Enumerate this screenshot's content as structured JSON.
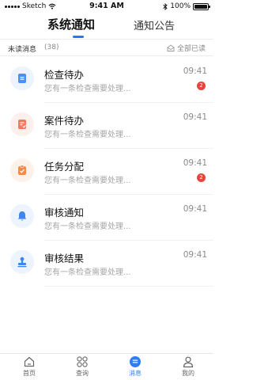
{
  "status_bar": {
    "carrier": "Sketch",
    "time": "9:41 AM",
    "battery": "100%"
  },
  "tabs": [
    {
      "label": "系统通知",
      "active": true
    },
    {
      "label": "通知公告",
      "active": false
    }
  ],
  "unread": {
    "label": "未读消息",
    "count": "(38)",
    "mark_all_read": "全部已读"
  },
  "messages": [
    {
      "title": "检查待办",
      "preview": "您有一条检查需要处理...",
      "time": "09:41",
      "badge": "2",
      "icon": "document-icon",
      "icon_color": "#4a8ef7",
      "icon_bg": "#eef4fd"
    },
    {
      "title": "案件待办",
      "preview": "您有一条检查需要处理...",
      "time": "09:41",
      "badge": "",
      "icon": "case-file-icon",
      "icon_color": "#f27a5c",
      "icon_bg": "#fdf0ec"
    },
    {
      "title": "任务分配",
      "preview": "您有一条检查需要处理...",
      "time": "09:41",
      "badge": "2",
      "icon": "clipboard-icon",
      "icon_color": "#f28a4c",
      "icon_bg": "#fdf2ea"
    },
    {
      "title": "审核通知",
      "preview": "您有一条检查需要处理...",
      "time": "09:41",
      "badge": "",
      "icon": "bell-icon",
      "icon_color": "#3f85f0",
      "icon_bg": "#eef4fd"
    },
    {
      "title": "审核结果",
      "preview": "您有一条检查需要处理...",
      "time": "09:41",
      "badge": "",
      "icon": "stamp-icon",
      "icon_color": "#3f85f0",
      "icon_bg": "#eef4fd"
    }
  ],
  "tab_bar": [
    {
      "label": "首页",
      "icon": "home-icon",
      "active": false
    },
    {
      "label": "查询",
      "icon": "grid-icon",
      "active": false
    },
    {
      "label": "消息",
      "icon": "message-icon",
      "active": true
    },
    {
      "label": "我的",
      "icon": "profile-icon",
      "active": false
    }
  ],
  "colors": {
    "accent": "#1f7bf2",
    "badge": "#e5453b"
  }
}
